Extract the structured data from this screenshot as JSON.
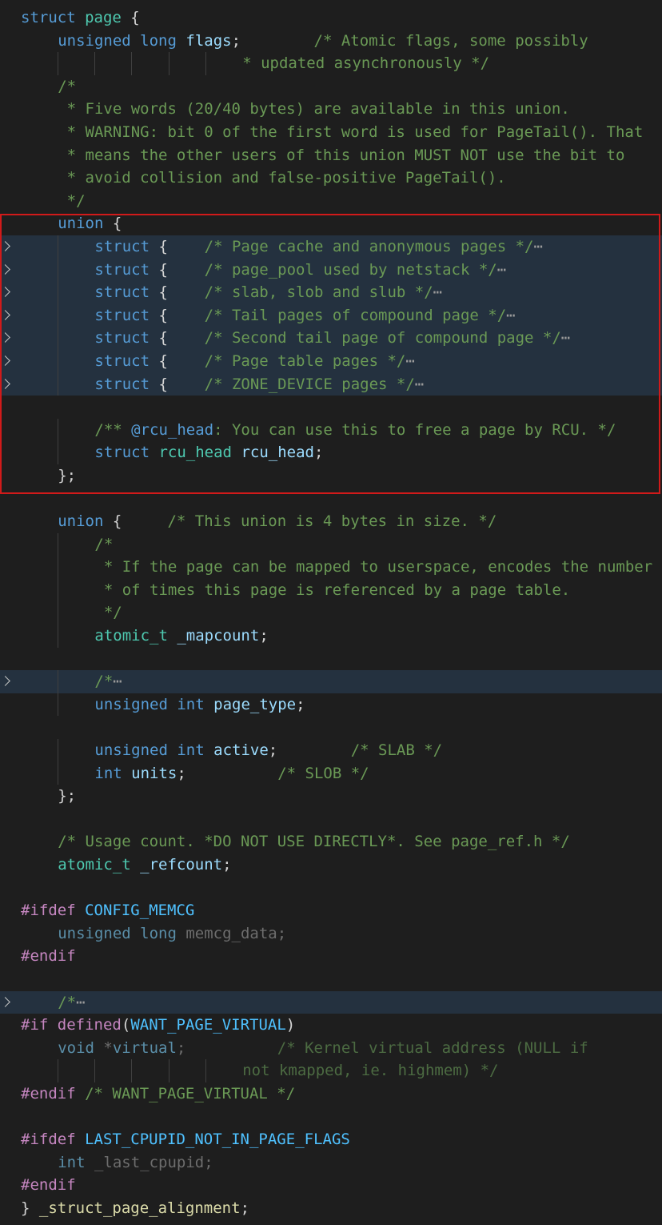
{
  "editor": {
    "accent_color": "#d11a1a",
    "folded_line_background": "#24313f",
    "lines": [
      {
        "indent": 0,
        "folded": false,
        "segments": [
          {
            "cls": "k",
            "text": "struct"
          },
          {
            "cls": "",
            "text": " "
          },
          {
            "cls": "t",
            "text": "page"
          },
          {
            "cls": "",
            "text": " {"
          }
        ]
      },
      {
        "indent": 1,
        "folded": false,
        "segments": [
          {
            "cls": "k",
            "text": "unsigned"
          },
          {
            "cls": "",
            "text": " "
          },
          {
            "cls": "k",
            "text": "long"
          },
          {
            "cls": "",
            "text": " "
          },
          {
            "cls": "v",
            "text": "flags"
          },
          {
            "cls": "",
            "text": ";        "
          },
          {
            "cls": "c",
            "text": "/* Atomic flags, some possibly"
          }
        ]
      },
      {
        "indent": 6,
        "folded": false,
        "segments": [
          {
            "cls": "c",
            "text": "* updated asynchronously */"
          }
        ]
      },
      {
        "indent": 1,
        "folded": false,
        "segments": [
          {
            "cls": "c",
            "text": "/*"
          }
        ]
      },
      {
        "indent": 1,
        "folded": false,
        "segments": [
          {
            "cls": "c",
            "text": " * Five words (20/40 bytes) are available in this union."
          }
        ]
      },
      {
        "indent": 1,
        "folded": false,
        "segments": [
          {
            "cls": "c",
            "text": " * WARNING: bit 0 of the first word is used for PageTail(). That"
          }
        ]
      },
      {
        "indent": 1,
        "folded": false,
        "segments": [
          {
            "cls": "c",
            "text": " * means the other users of this union MUST NOT use the bit to"
          }
        ]
      },
      {
        "indent": 1,
        "folded": false,
        "segments": [
          {
            "cls": "c",
            "text": " * avoid collision and false-positive PageTail()."
          }
        ]
      },
      {
        "indent": 1,
        "folded": false,
        "segments": [
          {
            "cls": "c",
            "text": " */"
          }
        ]
      },
      {
        "indent": 1,
        "folded": false,
        "segments": [
          {
            "cls": "k",
            "text": "union"
          },
          {
            "cls": "",
            "text": " {"
          }
        ]
      },
      {
        "indent": 2,
        "folded": true,
        "segments": [
          {
            "cls": "k",
            "text": "struct"
          },
          {
            "cls": "",
            "text": " {    "
          },
          {
            "cls": "c",
            "text": "/* Page cache and anonymous pages */"
          },
          {
            "cls": "dots",
            "text": "⋯"
          }
        ]
      },
      {
        "indent": 2,
        "folded": true,
        "segments": [
          {
            "cls": "k",
            "text": "struct"
          },
          {
            "cls": "",
            "text": " {    "
          },
          {
            "cls": "c",
            "text": "/* page_pool used by netstack */"
          },
          {
            "cls": "dots",
            "text": "⋯"
          }
        ]
      },
      {
        "indent": 2,
        "folded": true,
        "segments": [
          {
            "cls": "k",
            "text": "struct"
          },
          {
            "cls": "",
            "text": " {    "
          },
          {
            "cls": "c",
            "text": "/* slab, slob and slub */"
          },
          {
            "cls": "dots",
            "text": "⋯"
          }
        ]
      },
      {
        "indent": 2,
        "folded": true,
        "segments": [
          {
            "cls": "k",
            "text": "struct"
          },
          {
            "cls": "",
            "text": " {    "
          },
          {
            "cls": "c",
            "text": "/* Tail pages of compound page */"
          },
          {
            "cls": "dots",
            "text": "⋯"
          }
        ]
      },
      {
        "indent": 2,
        "folded": true,
        "segments": [
          {
            "cls": "k",
            "text": "struct"
          },
          {
            "cls": "",
            "text": " {    "
          },
          {
            "cls": "c",
            "text": "/* Second tail page of compound page */"
          },
          {
            "cls": "dots",
            "text": "⋯"
          }
        ]
      },
      {
        "indent": 2,
        "folded": true,
        "segments": [
          {
            "cls": "k",
            "text": "struct"
          },
          {
            "cls": "",
            "text": " {    "
          },
          {
            "cls": "c",
            "text": "/* Page table pages */"
          },
          {
            "cls": "dots",
            "text": "⋯"
          }
        ]
      },
      {
        "indent": 2,
        "folded": true,
        "segments": [
          {
            "cls": "k",
            "text": "struct"
          },
          {
            "cls": "",
            "text": " {    "
          },
          {
            "cls": "c",
            "text": "/* ZONE_DEVICE pages */"
          },
          {
            "cls": "dots",
            "text": "⋯"
          }
        ]
      },
      {
        "indent": 0,
        "folded": false,
        "segments": []
      },
      {
        "indent": 2,
        "folded": false,
        "segments": [
          {
            "cls": "c",
            "text": "/** "
          },
          {
            "cls": "k",
            "text": "@rcu_head"
          },
          {
            "cls": "c",
            "text": ": You can use this to free a page by RCU. */"
          }
        ]
      },
      {
        "indent": 2,
        "folded": false,
        "segments": [
          {
            "cls": "k",
            "text": "struct"
          },
          {
            "cls": "",
            "text": " "
          },
          {
            "cls": "t",
            "text": "rcu_head"
          },
          {
            "cls": "",
            "text": " "
          },
          {
            "cls": "v",
            "text": "rcu_head"
          },
          {
            "cls": "",
            "text": ";"
          }
        ]
      },
      {
        "indent": 1,
        "folded": false,
        "segments": [
          {
            "cls": "",
            "text": "};"
          }
        ]
      },
      {
        "indent": 0,
        "folded": false,
        "segments": []
      },
      {
        "indent": 1,
        "folded": false,
        "segments": [
          {
            "cls": "k",
            "text": "union"
          },
          {
            "cls": "",
            "text": " {     "
          },
          {
            "cls": "c",
            "text": "/* This union is 4 bytes in size. */"
          }
        ]
      },
      {
        "indent": 2,
        "folded": false,
        "segments": [
          {
            "cls": "c",
            "text": "/*"
          }
        ]
      },
      {
        "indent": 2,
        "folded": false,
        "segments": [
          {
            "cls": "c",
            "text": " * If the page can be mapped to userspace, encodes the number"
          }
        ]
      },
      {
        "indent": 2,
        "folded": false,
        "segments": [
          {
            "cls": "c",
            "text": " * of times this page is referenced by a page table."
          }
        ]
      },
      {
        "indent": 2,
        "folded": false,
        "segments": [
          {
            "cls": "c",
            "text": " */"
          }
        ]
      },
      {
        "indent": 2,
        "folded": false,
        "segments": [
          {
            "cls": "t",
            "text": "atomic_t"
          },
          {
            "cls": "",
            "text": " "
          },
          {
            "cls": "v",
            "text": "_mapcount"
          },
          {
            "cls": "",
            "text": ";"
          }
        ]
      },
      {
        "indent": 0,
        "folded": false,
        "segments": []
      },
      {
        "indent": 2,
        "folded": true,
        "segments": [
          {
            "cls": "c",
            "text": "/*"
          },
          {
            "cls": "dots",
            "text": "⋯"
          }
        ]
      },
      {
        "indent": 2,
        "folded": false,
        "segments": [
          {
            "cls": "k",
            "text": "unsigned"
          },
          {
            "cls": "",
            "text": " "
          },
          {
            "cls": "k",
            "text": "int"
          },
          {
            "cls": "",
            "text": " "
          },
          {
            "cls": "v",
            "text": "page_type"
          },
          {
            "cls": "",
            "text": ";"
          }
        ]
      },
      {
        "indent": 0,
        "folded": false,
        "segments": []
      },
      {
        "indent": 2,
        "folded": false,
        "segments": [
          {
            "cls": "k",
            "text": "unsigned"
          },
          {
            "cls": "",
            "text": " "
          },
          {
            "cls": "k",
            "text": "int"
          },
          {
            "cls": "",
            "text": " "
          },
          {
            "cls": "v",
            "text": "active"
          },
          {
            "cls": "",
            "text": ";        "
          },
          {
            "cls": "c",
            "text": "/* SLAB */"
          }
        ]
      },
      {
        "indent": 2,
        "folded": false,
        "segments": [
          {
            "cls": "k",
            "text": "int"
          },
          {
            "cls": "",
            "text": " "
          },
          {
            "cls": "v",
            "text": "units"
          },
          {
            "cls": "",
            "text": ";          "
          },
          {
            "cls": "c",
            "text": "/* SLOB */"
          }
        ]
      },
      {
        "indent": 1,
        "folded": false,
        "segments": [
          {
            "cls": "",
            "text": "};"
          }
        ]
      },
      {
        "indent": 0,
        "folded": false,
        "segments": []
      },
      {
        "indent": 1,
        "folded": false,
        "segments": [
          {
            "cls": "c",
            "text": "/* Usage count. *DO NOT USE DIRECTLY*. See page_ref.h */"
          }
        ]
      },
      {
        "indent": 1,
        "folded": false,
        "segments": [
          {
            "cls": "t",
            "text": "atomic_t"
          },
          {
            "cls": "",
            "text": " "
          },
          {
            "cls": "v",
            "text": "_refcount"
          },
          {
            "cls": "",
            "text": ";"
          }
        ]
      },
      {
        "indent": 0,
        "folded": false,
        "segments": []
      },
      {
        "indent": 0,
        "folded": false,
        "segments": [
          {
            "cls": "p",
            "text": "#ifdef"
          },
          {
            "cls": "",
            "text": " "
          },
          {
            "cls": "m",
            "text": "CONFIG_MEMCG"
          }
        ]
      },
      {
        "indent": 1,
        "folded": false,
        "segments": [
          {
            "cls": "vd",
            "text": "unsigned"
          },
          {
            "cls": "dim",
            "text": " "
          },
          {
            "cls": "vd",
            "text": "long"
          },
          {
            "cls": "dim",
            "text": " memcg_data;"
          }
        ]
      },
      {
        "indent": 0,
        "folded": false,
        "segments": [
          {
            "cls": "p",
            "text": "#endif"
          }
        ]
      },
      {
        "indent": 0,
        "folded": false,
        "segments": []
      },
      {
        "indent": 1,
        "folded": true,
        "segments": [
          {
            "cls": "c",
            "text": "/*"
          },
          {
            "cls": "dots",
            "text": "⋯"
          }
        ]
      },
      {
        "indent": 0,
        "folded": false,
        "segments": [
          {
            "cls": "p",
            "text": "#if"
          },
          {
            "cls": "",
            "text": " "
          },
          {
            "cls": "p",
            "text": "defined"
          },
          {
            "cls": "",
            "text": "("
          },
          {
            "cls": "m",
            "text": "WANT_PAGE_VIRTUAL"
          },
          {
            "cls": "",
            "text": ")"
          }
        ]
      },
      {
        "indent": 1,
        "folded": false,
        "segments": [
          {
            "cls": "vd",
            "text": "void"
          },
          {
            "cls": "dim",
            "text": " *"
          },
          {
            "cls": "vd",
            "text": "virtual"
          },
          {
            "cls": "dim",
            "text": ";          "
          },
          {
            "cls": "cd",
            "text": "/* Kernel virtual address (NULL if"
          }
        ]
      },
      {
        "indent": 6,
        "folded": false,
        "segments": [
          {
            "cls": "cd",
            "text": "not kmapped, ie. highmem) */"
          }
        ]
      },
      {
        "indent": 0,
        "folded": false,
        "segments": [
          {
            "cls": "p",
            "text": "#endif"
          },
          {
            "cls": "",
            "text": " "
          },
          {
            "cls": "c",
            "text": "/* WANT_PAGE_VIRTUAL */"
          }
        ]
      },
      {
        "indent": 0,
        "folded": false,
        "segments": []
      },
      {
        "indent": 0,
        "folded": false,
        "segments": [
          {
            "cls": "p",
            "text": "#ifdef"
          },
          {
            "cls": "",
            "text": " "
          },
          {
            "cls": "m",
            "text": "LAST_CPUPID_NOT_IN_PAGE_FLAGS"
          }
        ]
      },
      {
        "indent": 1,
        "folded": false,
        "segments": [
          {
            "cls": "vd",
            "text": "int"
          },
          {
            "cls": "dim",
            "text": " _last_cpupid;"
          }
        ]
      },
      {
        "indent": 0,
        "folded": false,
        "segments": [
          {
            "cls": "p",
            "text": "#endif"
          }
        ]
      },
      {
        "indent": 0,
        "folded": false,
        "segments": [
          {
            "cls": "",
            "text": "} "
          },
          {
            "cls": "f",
            "text": "_struct_page_alignment"
          },
          {
            "cls": "",
            "text": ";"
          }
        ]
      }
    ]
  }
}
